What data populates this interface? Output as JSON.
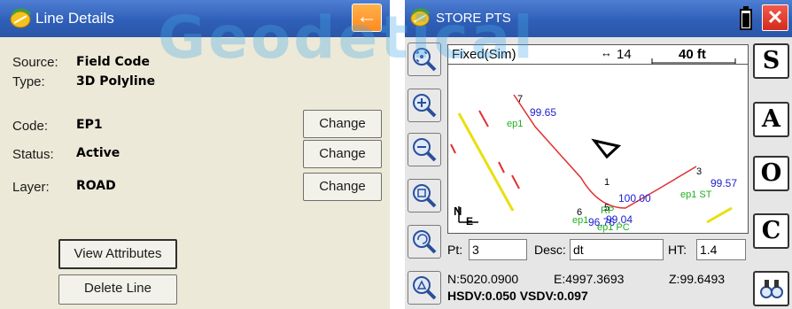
{
  "line_details": {
    "title": "Line Details",
    "back_label": "←",
    "source_label": "Source:",
    "source_value": "Field Code",
    "type_label": "Type:",
    "type_value": "3D Polyline",
    "code_label": "Code:",
    "code_value": "EP1",
    "status_label": "Status:",
    "status_value": "Active",
    "layer_label": "Layer:",
    "layer_value": "ROAD",
    "change_label": "Change",
    "view_attributes_label": "View Attributes",
    "delete_line_label": "Delete Line"
  },
  "store_pts": {
    "title": "STORE PTS",
    "close_label": "✕",
    "status_mode": "Fixed(Sim)",
    "satellites": "14",
    "scale": "40 ft",
    "side_buttons": [
      "S",
      "A",
      "O",
      "C"
    ],
    "map_labels": {
      "pt7": "7",
      "pt7_elev": "99.65",
      "pt7_code": "ep1",
      "pt1": "1",
      "pt1_elev": "100.00",
      "pt3": "3",
      "pt3_elev": "99.57",
      "pt3_code": "ep1 ST",
      "pt6": "6",
      "rp": "RP",
      "pt6_elev": "96.76",
      "pt5": "5",
      "pt4_elev": "99.04",
      "pt4_code": "ep1",
      "pc_code": "ep1 PC",
      "north": "N",
      "east": "E"
    },
    "pt_label": "Pt:",
    "pt_value": "3",
    "desc_label": "Desc:",
    "desc_value": "dt",
    "ht_label": "HT:",
    "ht_value": "1.4",
    "north": "N:5020.0900",
    "east": "E:4997.3693",
    "elev": "Z:99.6493",
    "precision": "HSDV:0.050 VSDV:0.097"
  },
  "watermark": "Geodetical",
  "colors": {
    "titlebar": "#2f5fb8",
    "back_button": "#ff8a1f",
    "close_button": "#d22c1c",
    "line_red": "#e03030",
    "elev_blue": "#2020d0",
    "code_green": "#20b020"
  }
}
